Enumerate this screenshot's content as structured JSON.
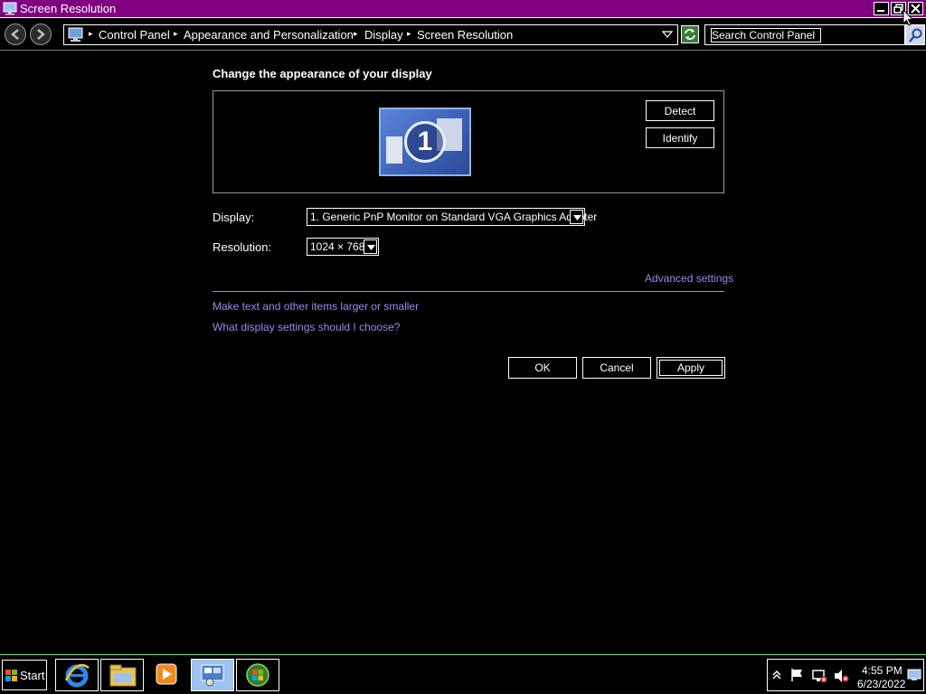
{
  "window": {
    "title": "Screen Resolution"
  },
  "address_bar": {
    "breadcrumbs": [
      "Control Panel",
      "Appearance and Personalization",
      "Display",
      "Screen Resolution"
    ],
    "search_placeholder": "Search Control Panel"
  },
  "main": {
    "heading": "Change the appearance of your display",
    "monitor_number": "1",
    "detect_label": "Detect",
    "identify_label": "Identify",
    "display_label": "Display:",
    "display_value": "1. Generic PnP Monitor on Standard VGA Graphics Adapter",
    "resolution_label": "Resolution:",
    "resolution_value": "1024 × 768",
    "advanced_link": "Advanced settings",
    "links": [
      "Make text and other items larger or smaller",
      "What display settings should I choose?"
    ],
    "ok_label": "OK",
    "cancel_label": "Cancel",
    "apply_label": "Apply"
  },
  "taskbar": {
    "start_label": "Start",
    "pinned": [
      "internet-explorer-icon",
      "windows-explorer-icon",
      "media-player-icon",
      "control-panel-icon",
      "windows-update-icon"
    ],
    "clock_time": "4:55 PM",
    "clock_date": "6/23/2022"
  },
  "colors": {
    "title_bar": "#800080",
    "background": "#000000",
    "link": "#8f8ff2",
    "taskbar_border": "#6cff6c"
  }
}
